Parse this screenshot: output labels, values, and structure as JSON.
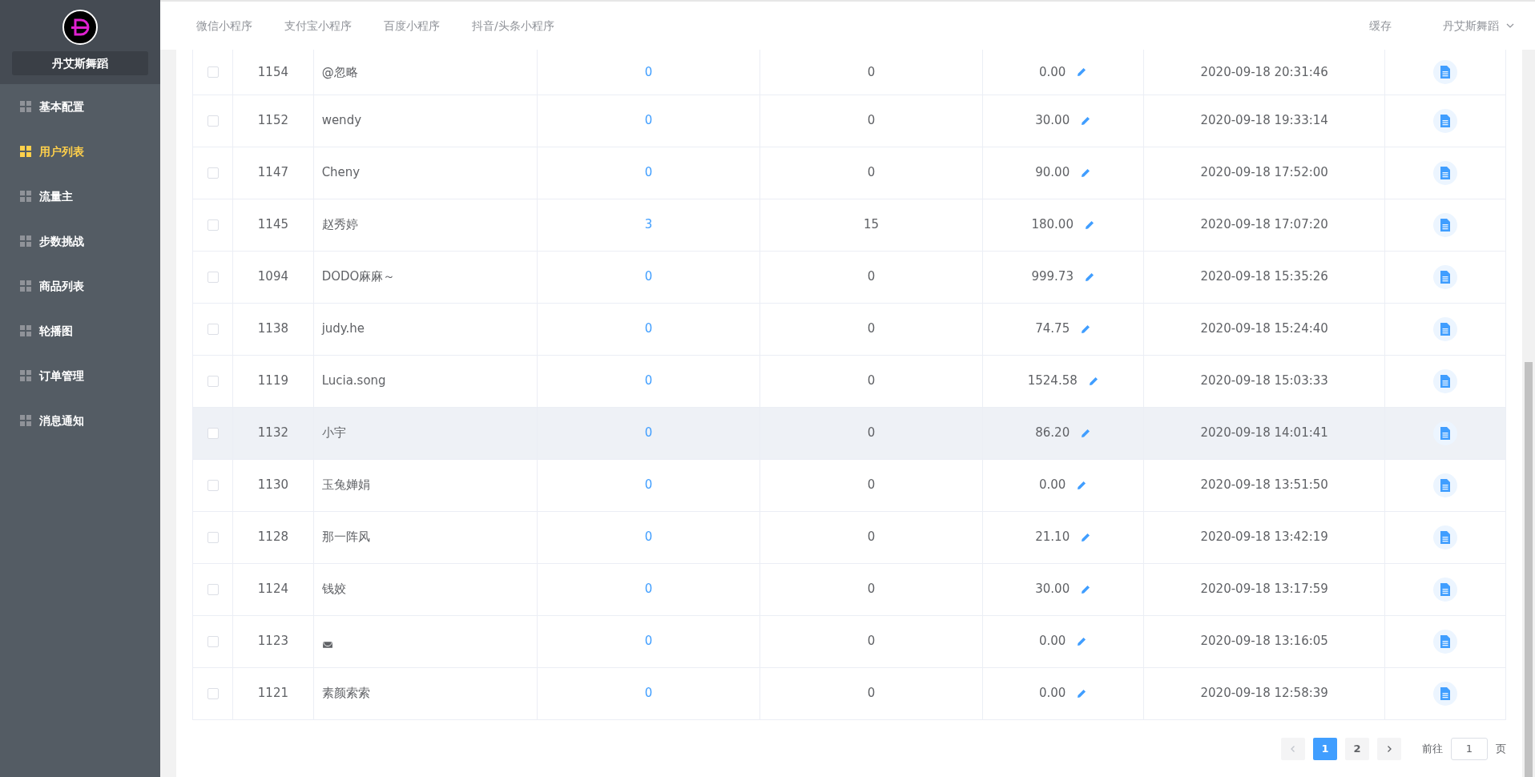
{
  "sidebar": {
    "brand": "丹艾斯舞蹈",
    "items": [
      {
        "label": "基本配置",
        "selected": false
      },
      {
        "label": "用户列表",
        "selected": true
      },
      {
        "label": "流量主",
        "selected": false
      },
      {
        "label": "步数挑战",
        "selected": false
      },
      {
        "label": "商品列表",
        "selected": false
      },
      {
        "label": "轮播图",
        "selected": false
      },
      {
        "label": "订单管理",
        "selected": false
      },
      {
        "label": "消息通知",
        "selected": false
      }
    ]
  },
  "header": {
    "tabs": [
      "微信小程序",
      "支付宝小程序",
      "百度小程序",
      "抖音/头条小程序"
    ],
    "cache": "缓存",
    "user": "丹艾斯舞蹈"
  },
  "table": {
    "rows": [
      {
        "id": "1154",
        "name": "@忽略",
        "column_3": "0",
        "column_4": "0",
        "amount": "0.00",
        "time": "2020-09-18 20:31:46",
        "checked": false,
        "highlighted": false
      },
      {
        "id": "1152",
        "name": "wendy",
        "column_3": "0",
        "column_4": "0",
        "amount": "30.00",
        "time": "2020-09-18 19:33:14",
        "checked": false,
        "highlighted": false
      },
      {
        "id": "1147",
        "name": "Cheny",
        "column_3": "0",
        "column_4": "0",
        "amount": "90.00",
        "time": "2020-09-18 17:52:00",
        "checked": false,
        "highlighted": false
      },
      {
        "id": "1145",
        "name": "赵秀婷",
        "column_3": "3",
        "column_4": "15",
        "amount": "180.00",
        "time": "2020-09-18 17:07:20",
        "checked": false,
        "highlighted": false
      },
      {
        "id": "1094",
        "name": "DODO麻麻～",
        "column_3": "0",
        "column_4": "0",
        "amount": "999.73",
        "time": "2020-09-18 15:35:26",
        "checked": false,
        "highlighted": false
      },
      {
        "id": "1138",
        "name": "judy.he",
        "column_3": "0",
        "column_4": "0",
        "amount": "74.75",
        "time": "2020-09-18 15:24:40",
        "checked": false,
        "highlighted": false
      },
      {
        "id": "1119",
        "name": "Lucia.song",
        "column_3": "0",
        "column_4": "0",
        "amount": "1524.58",
        "time": "2020-09-18 15:03:33",
        "checked": false,
        "highlighted": false
      },
      {
        "id": "1132",
        "name": "小宇",
        "column_3": "0",
        "column_4": "0",
        "amount": "86.20",
        "time": "2020-09-18 14:01:41",
        "checked": false,
        "highlighted": true
      },
      {
        "id": "1130",
        "name": "玉兔婵娟",
        "column_3": "0",
        "column_4": "0",
        "amount": "0.00",
        "time": "2020-09-18 13:51:50",
        "checked": false,
        "highlighted": false
      },
      {
        "id": "1128",
        "name": "那一阵风",
        "column_3": "0",
        "column_4": "0",
        "amount": "21.10",
        "time": "2020-09-18 13:42:19",
        "checked": false,
        "highlighted": false
      },
      {
        "id": "1124",
        "name": "钱姣",
        "column_3": "0",
        "column_4": "0",
        "amount": "30.00",
        "time": "2020-09-18 13:17:59",
        "checked": false,
        "highlighted": false
      },
      {
        "id": "1123",
        "name": "◛",
        "column_3": "0",
        "column_4": "0",
        "amount": "0.00",
        "time": "2020-09-18 13:16:05",
        "checked": false,
        "highlighted": false
      },
      {
        "id": "1121",
        "name": "素颜索索",
        "column_3": "0",
        "column_4": "0",
        "amount": "0.00",
        "time": "2020-09-18 12:58:39",
        "checked": false,
        "highlighted": false
      }
    ]
  },
  "pagination": {
    "pages": [
      {
        "label": "1",
        "selected": true
      },
      {
        "label": "2",
        "selected": false
      }
    ],
    "prev_disabled": true,
    "next_disabled": false,
    "goto_label": "前往",
    "goto_value": "1",
    "goto_suffix": "页"
  }
}
